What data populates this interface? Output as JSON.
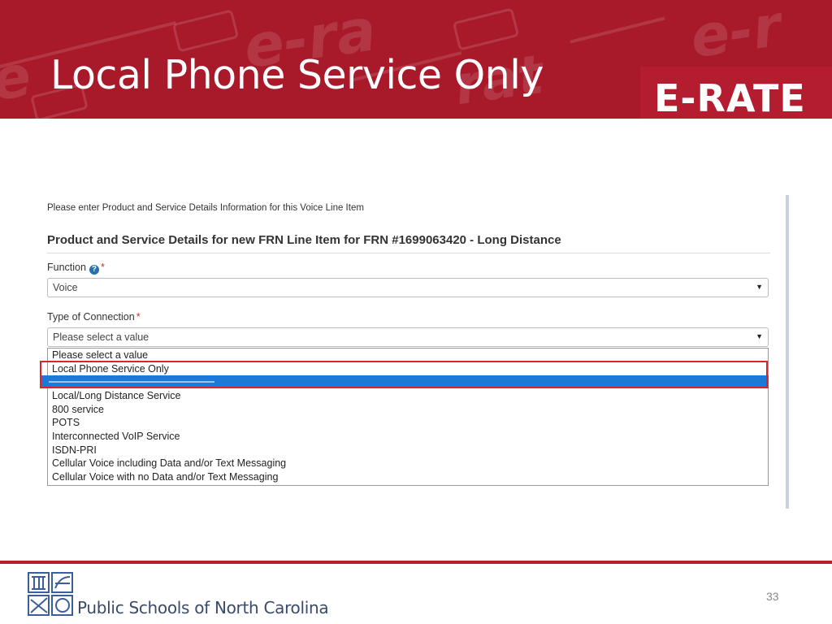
{
  "slide": {
    "title": "Local Phone Service Only",
    "logo_text": "E-RATE",
    "page_number": "33"
  },
  "form": {
    "intro": "Please enter Product and Service Details Information for this Voice Line Item",
    "section_title": "Product and Service Details for new FRN Line Item for FRN #1699063420 - Long Distance",
    "function_field": {
      "label": "Function",
      "required_mark": "*",
      "help_icon": "question-circle-icon",
      "value": "Voice"
    },
    "connection_field": {
      "label": "Type of Connection",
      "required_mark": "*",
      "value": "Please select a value",
      "options": [
        "Please select a value",
        "Local Phone Service Only",
        "Local/Long Distance Service",
        "800 service",
        "POTS",
        "Interconnected VoIP Service",
        "ISDN-PRI",
        "Cellular Voice including Data and/or Text Messaging",
        "Cellular Voice with no Data and/or Text Messaging"
      ],
      "highlighted_option": "Local Phone Service Only"
    }
  },
  "footer": {
    "org_name": "Public Schools of North Carolina",
    "logo_icon": "ncdpi-seal-icon"
  },
  "colors": {
    "banner_red": "#a8192a",
    "highlight_blue": "#1e78d8",
    "callout_red": "#d9232e"
  }
}
